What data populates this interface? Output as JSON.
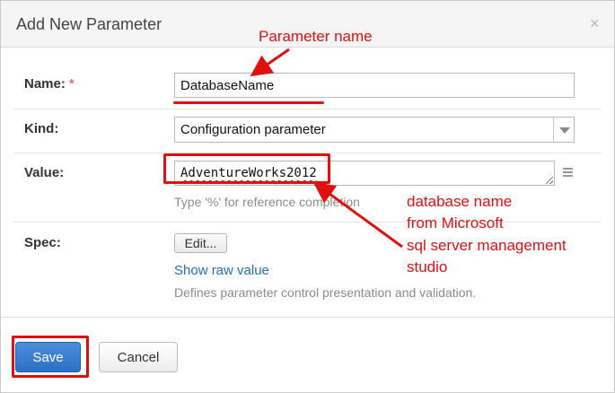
{
  "dialog": {
    "title": "Add New Parameter",
    "close_glyph": "×"
  },
  "form": {
    "name": {
      "label": "Name:",
      "required_mark": "*",
      "value": "DatabaseName"
    },
    "kind": {
      "label": "Kind:",
      "selected": "Configuration parameter"
    },
    "value": {
      "label": "Value:",
      "value": "AdventureWorks2012",
      "hint": "Type '%' for reference completion"
    },
    "spec": {
      "label": "Spec:",
      "edit_label": "Edit...",
      "raw_link": "Show raw value",
      "description": "Defines parameter control presentation and validation."
    }
  },
  "footer": {
    "save_label": "Save",
    "cancel_label": "Cancel"
  },
  "annotations": {
    "parameter_name": "Parameter name",
    "database_name_lines": [
      "database name",
      "from Microsoft",
      "sql server management",
      "studio"
    ],
    "color": "#e01010"
  },
  "colors": {
    "primary_button": "#2d6fc2",
    "link": "#1f6fb8",
    "required": "#e23b3b"
  }
}
